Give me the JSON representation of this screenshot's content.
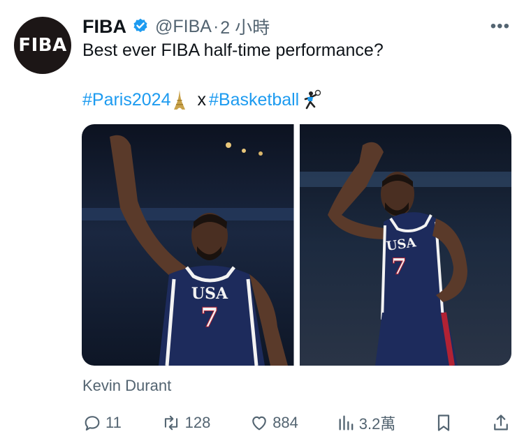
{
  "author": {
    "avatar_text": "FIBA",
    "display_name": "FIBA",
    "handle": "@FIBA",
    "separator": "·",
    "time": "2 小時"
  },
  "more_label": "•••",
  "tweet": {
    "text": "Best ever FIBA half-time performance?",
    "hashtag_1": "#Paris2024",
    "connector": "x",
    "hashtag_2": "#Basketball"
  },
  "media": {
    "photo_1_text": "USA",
    "photo_1_number": "7",
    "photo_2_text": "USA",
    "photo_2_number": "7"
  },
  "tagged_person": "Kevin Durant",
  "actions": {
    "replies": "11",
    "reposts": "128",
    "likes": "884",
    "views": "3.2萬"
  },
  "colors": {
    "link": "#1d9bf0",
    "verified": "#1d9bf0",
    "muted": "#536471",
    "jersey": "#1d2b5c"
  }
}
